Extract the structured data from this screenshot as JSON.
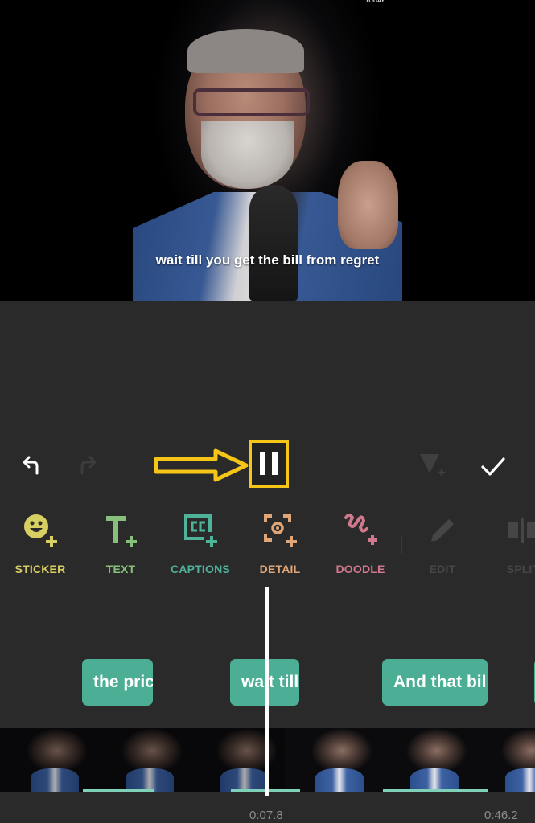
{
  "preview": {
    "subtitle": "wait till you get the bill from regret",
    "watermark": "TODAY"
  },
  "controls": {
    "undo_icon": "undo-arrow-icon",
    "redo_icon": "redo-arrow-icon",
    "pause_icon": "pause-icon",
    "keyframe_icon": "add-keyframe-icon",
    "confirm_icon": "checkmark-icon",
    "annotation_color": "#f5c518"
  },
  "tools": [
    {
      "label": "STICKER",
      "icon": "sticker-add-icon",
      "color": "#d8cf62",
      "enabled": true
    },
    {
      "label": "TEXT",
      "icon": "text-add-icon",
      "color": "#86c07a",
      "enabled": true
    },
    {
      "label": "CAPTIONS",
      "icon": "captions-add-icon",
      "color": "#4fb39a",
      "enabled": true
    },
    {
      "label": "DETAIL",
      "icon": "detail-add-icon",
      "color": "#e0a677",
      "enabled": true
    },
    {
      "label": "DOODLE",
      "icon": "doodle-add-icon",
      "color": "#d0788e",
      "enabled": true
    },
    {
      "label": "EDIT",
      "icon": "pencil-icon",
      "color": "#4a4a4a",
      "enabled": false
    },
    {
      "label": "SPLIT",
      "icon": "split-icon",
      "color": "#4a4a4a",
      "enabled": false
    }
  ],
  "caption_track": [
    {
      "text": "the pric"
    },
    {
      "text": "wait till"
    },
    {
      "text": "And that bil"
    },
    {
      "text": ""
    }
  ],
  "timeline": {
    "current_time": "0:07.8",
    "total_duration": "0:46.2"
  },
  "colors": {
    "caption_chip": "#4caf95",
    "background": "#2a2a2a"
  }
}
